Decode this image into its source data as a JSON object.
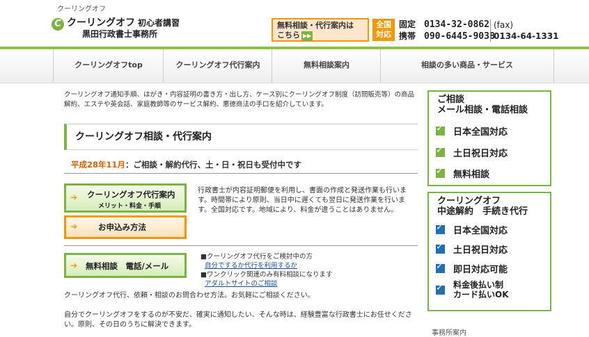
{
  "header": {
    "topline": "クーリングオフ",
    "logo_mark": "C",
    "logo_title": "クーリングオフ",
    "logo_title_sub": "初心者講習",
    "logo_sub": "黒田行政書士事務所",
    "banner_line1": "無料相談・代行案内は",
    "banner_line2": "こちら",
    "banner_play": "▶▶",
    "zenkoku_1": "全国",
    "zenkoku_2": "対応",
    "phone_fixed_label": "固定",
    "phone_fixed": "0134-32-0862",
    "phone_mobile_label": "携帯",
    "phone_mobile": "090-6445-9038",
    "fax_label": "(fax)",
    "fax": "0134-64-1331"
  },
  "nav": [
    "クーリングオフtop",
    "クーリングオフ代行案内",
    "無料相談案内",
    "相談の多い商品・サービス"
  ],
  "intro": "クーリングオフ通知手順、はがき・内容証明の書き方・出し方、ケース別にクーリングオフ制度（訪問販売等）の商品解約、エステや英会話、家庭教師等のサービス解約、悪徳商法の手口を紹介しています。",
  "section_title": "クーリングオフ相談・代行案内",
  "notice_date": "平成28年11月",
  "notice_text": "：ご相談・解約代行、土・日・祝日も受付中です",
  "buttons": {
    "agency_label": "クーリングオフ代行案内",
    "agency_sub": "メリット・料金・手順",
    "apply_label": "お申込み方法",
    "consult_label": "無料相談　電話/メール",
    "arrow": "➔"
  },
  "desc1": "行政書士が内容証明郵便を利用し、書面の作成と発送作業も行います。時間帯により原則、当日中に遅くても翌日に発送作業を行います。全国対応です。地域により、料金が違うことはありません。",
  "links": {
    "bullet1": "■クーリングオフ代行をご検討中の方",
    "link1": "自分でするか代行を利用するか",
    "bullet2": "■ワンクリック関連のみ有料相談になります",
    "link2": "アダルトサイトのご相談"
  },
  "para1": "クーリングオフ代行、依頼・相談のお問合わせ方法。お気軽にご相談ください。",
  "para2": "自分でクーリングオフをするのが不安だ、確実に通知したい、そんな時は、経験豊富な行政書士にお任せください。原則、その日のうちに解決できます。",
  "sidebar": {
    "box1_title1": "ご相談",
    "box1_title2": "メール相談・電話相談",
    "box1_items": [
      "日本全国対応",
      "土日祝日対応",
      "無料相談"
    ],
    "box2_title1": "クーリングオフ",
    "box2_title2": "中途解約　手続き代行",
    "box2_items": [
      "日本全国対応",
      "土日祝日対応",
      "即日対応可能"
    ],
    "box2_last_1": "料金後払い制",
    "box2_last_2": "カード払いOK",
    "bottom_text": "事務所案内"
  }
}
